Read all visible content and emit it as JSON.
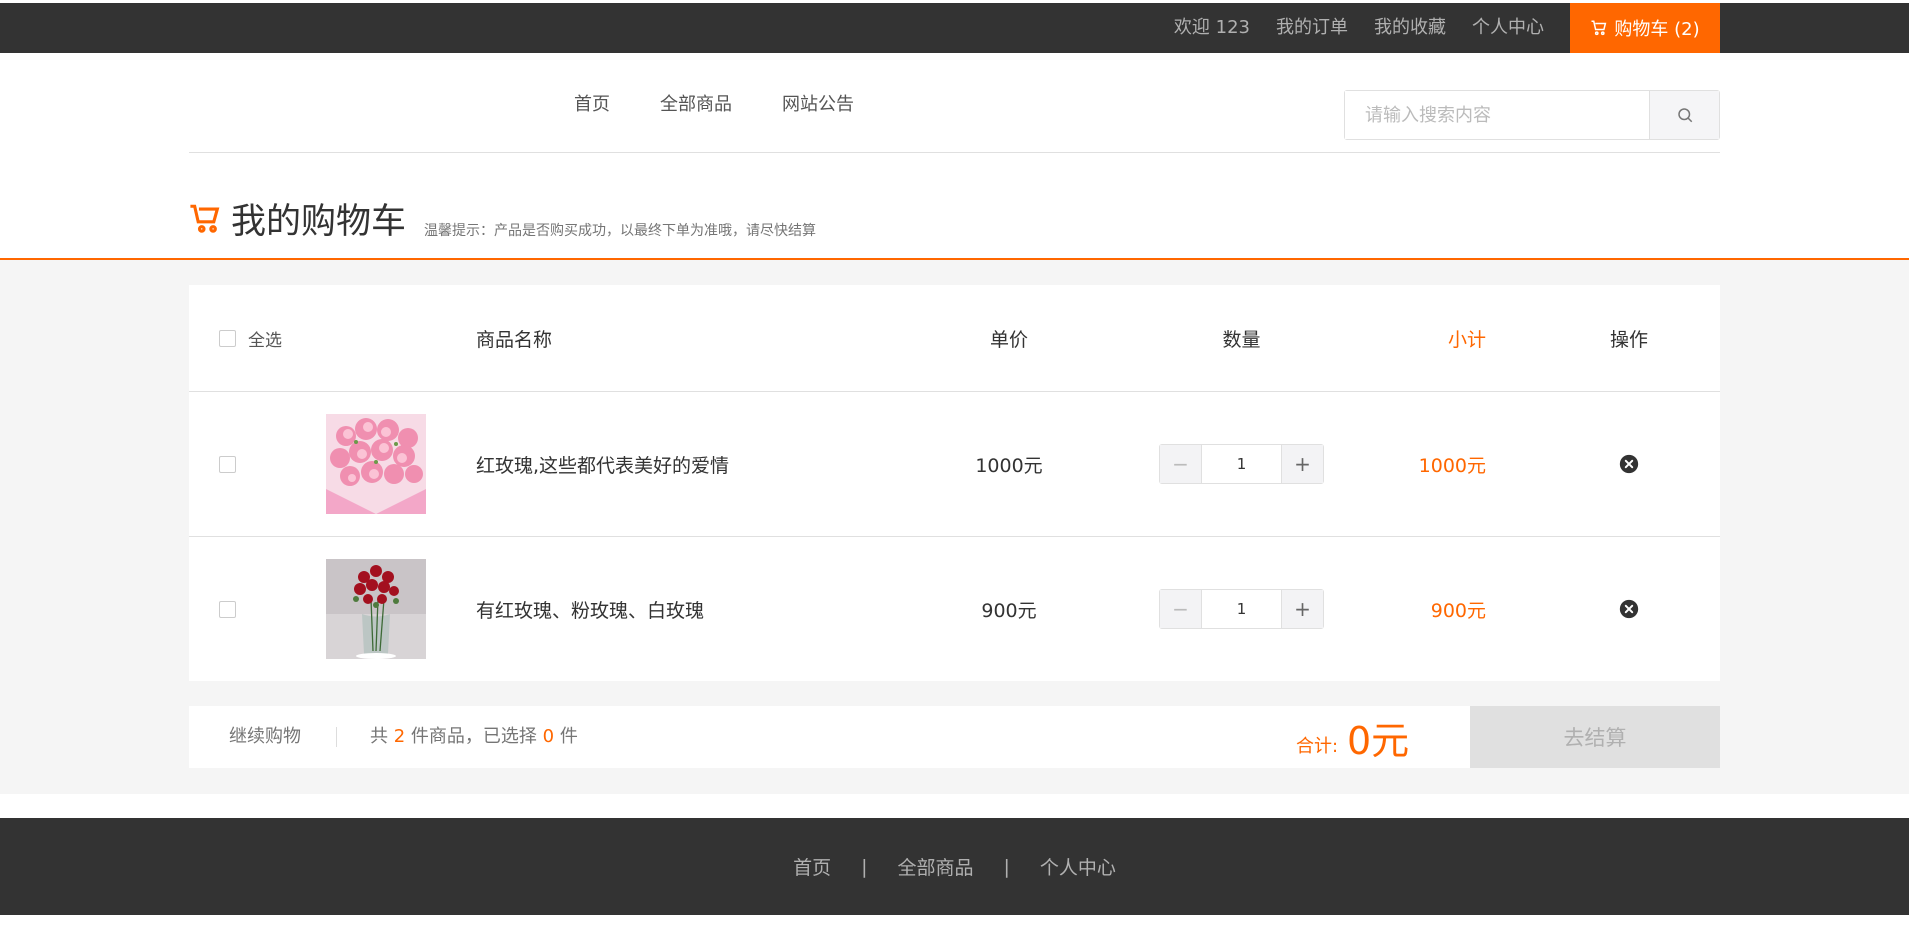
{
  "topbar": {
    "welcome": "欢迎 123",
    "orders": "我的订单",
    "favorites": "我的收藏",
    "profile": "个人中心",
    "cart": "购物车 (2)"
  },
  "nav": {
    "home": "首页",
    "all_products": "全部商品",
    "announcements": "网站公告"
  },
  "search": {
    "placeholder": "请输入搜索内容"
  },
  "page": {
    "title": "我的购物车",
    "tip": "温馨提示：产品是否购买成功，以最终下单为准哦，请尽快结算"
  },
  "table": {
    "select_all": "全选",
    "col_name": "商品名称",
    "col_price": "单价",
    "col_qty": "数量",
    "col_subtotal": "小计",
    "col_action": "操作"
  },
  "items": [
    {
      "name": "红玫瑰,这些都代表美好的爱情",
      "price": "1000元",
      "qty": "1",
      "subtotal": "1000元"
    },
    {
      "name": "有红玫瑰、粉玫瑰、白玫瑰",
      "price": "900元",
      "qty": "1",
      "subtotal": "900元"
    }
  ],
  "summary": {
    "continue": "继续购物",
    "count_prefix": "共",
    "total_count": "2",
    "count_mid": "件商品，已选择",
    "selected_count": "0",
    "count_suffix": "件",
    "total_label": "合计:",
    "total_value": "0元",
    "checkout": "去结算"
  },
  "footer": {
    "home": "首页",
    "all_products": "全部商品",
    "profile": "个人中心",
    "separator": "|"
  },
  "colors": {
    "accent": "#ff6700",
    "dark_bar": "#333333"
  }
}
